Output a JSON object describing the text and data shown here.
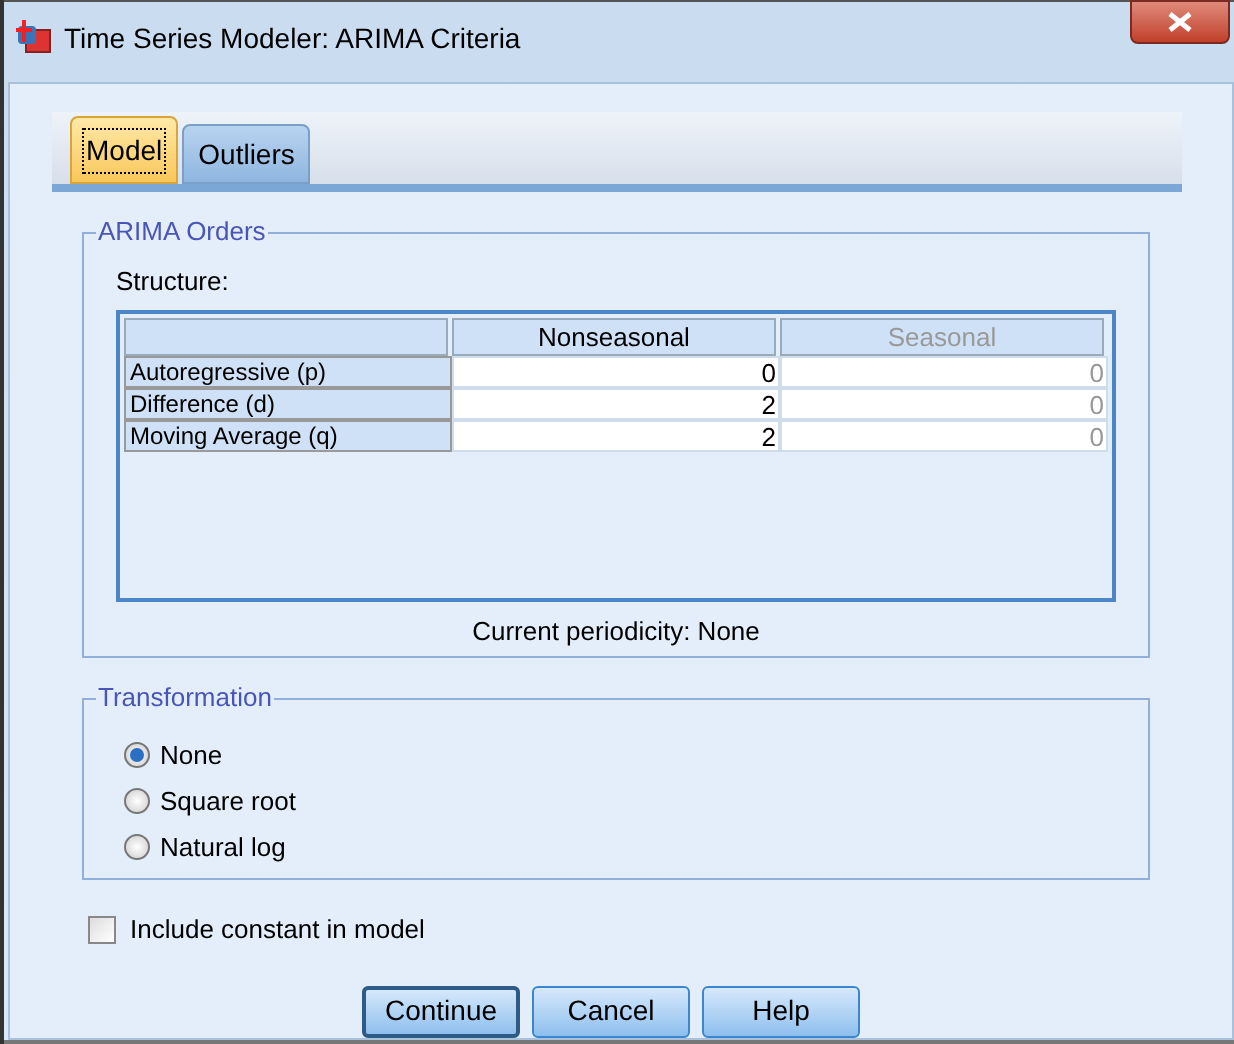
{
  "window": {
    "title": "Time Series Modeler: ARIMA Criteria"
  },
  "tabs": [
    {
      "label": "Model",
      "selected": true
    },
    {
      "label": "Outliers",
      "selected": false
    }
  ],
  "arima_orders": {
    "title": "ARIMA Orders",
    "structure_label": "Structure:",
    "columns": [
      {
        "label": "Nonseasonal",
        "disabled": false
      },
      {
        "label": "Seasonal",
        "disabled": true
      }
    ],
    "rows": [
      {
        "label": "Autoregressive (p)",
        "values": [
          "0",
          "0"
        ]
      },
      {
        "label": "Difference (d)",
        "values": [
          "2",
          "0"
        ]
      },
      {
        "label": "Moving Average (q)",
        "values": [
          "2",
          "0"
        ]
      }
    ],
    "periodicity": "Current periodicity: None"
  },
  "transformation": {
    "title": "Transformation",
    "options": [
      {
        "label": "None",
        "selected": true
      },
      {
        "label": "Square root",
        "selected": false
      },
      {
        "label": "Natural log",
        "selected": false
      }
    ]
  },
  "include_constant": {
    "label": "Include constant in model",
    "checked": false
  },
  "buttons": [
    {
      "label": "Continue",
      "default": true
    },
    {
      "label": "Cancel",
      "default": false
    },
    {
      "label": "Help",
      "default": false
    }
  ]
}
